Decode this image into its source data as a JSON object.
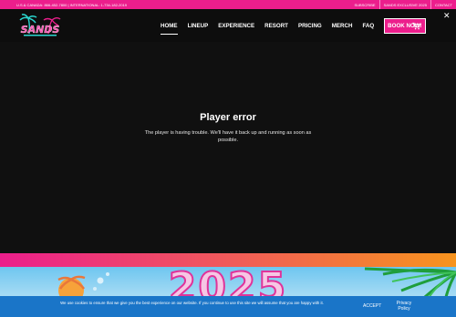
{
  "topbar": {
    "contact_line": "U.S.& CANADA: 866-452-7800 | INTERNATIONAL: 1-734-182-2019",
    "links": [
      "SUBSCRIBE",
      "SANDS EXCLUSIVE 2025",
      "CONTACT"
    ]
  },
  "header": {
    "logo_text": "SANDS",
    "nav": [
      "HOME",
      "LINEUP",
      "EXPERIENCE",
      "RESORT",
      "PRICING",
      "MERCH",
      "FAQ"
    ],
    "book_label": "BOOK NOW!",
    "cart_icon": "cart-icon",
    "close_icon": "close-icon"
  },
  "player": {
    "error_title": "Player error",
    "error_line1": "The player is having trouble. We'll have it back up and running as soon as",
    "error_line2": "possible."
  },
  "banner": {
    "year_text": "2025"
  },
  "cookie": {
    "message": "We use cookies to ensure that we give you the best experience on our website. If you continue to use this site we will assume that you are happy with it.",
    "accept_label": "ACCEPT",
    "privacy_label": "Privacy Policy"
  },
  "colors": {
    "accent_pink": "#ec1e8c",
    "cookie_blue": "#1a75c8",
    "header_black": "#0d0d0d"
  }
}
